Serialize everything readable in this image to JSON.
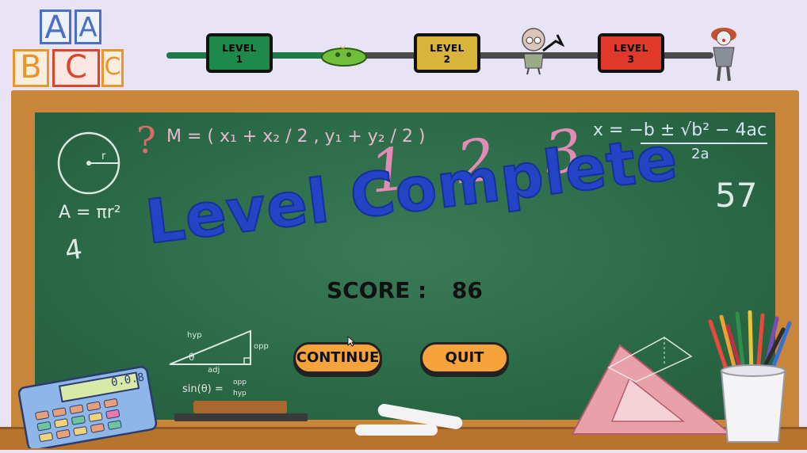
{
  "blocks": {
    "row1": [
      "A",
      "A"
    ],
    "row2": [
      "B",
      "C",
      "C"
    ]
  },
  "progress": {
    "levels": [
      {
        "label": "LEVEL",
        "num": "1",
        "color": "#1e8a4a"
      },
      {
        "label": "LEVEL",
        "num": "2",
        "color": "#d8b43a"
      },
      {
        "label": "LEVEL",
        "num": "3",
        "color": "#e0392a"
      }
    ],
    "completed_fraction": 0.3
  },
  "board": {
    "title": "Level Complete",
    "score_label": "SCORE :",
    "score_value": "86",
    "chalk": {
      "midpoint": "M = ( x₁ + x₂ / 2 , y₁ + y₂ / 2 )",
      "question": "?",
      "numbers": "1 2 3",
      "quadratic_top": "x = −b ± √b² − 4ac",
      "quadratic_bottom": "2a",
      "circle_r": "r",
      "area": "A = πr²",
      "four": "4",
      "fiftyseven": "57",
      "sin": "sin(θ) =",
      "opp": "opp",
      "hyp": "hyp",
      "adj": "adj",
      "theta": "θ"
    },
    "calculator_display": "0.0.8"
  },
  "buttons": {
    "continue": "CONTINUE",
    "quit": "QUIT"
  }
}
